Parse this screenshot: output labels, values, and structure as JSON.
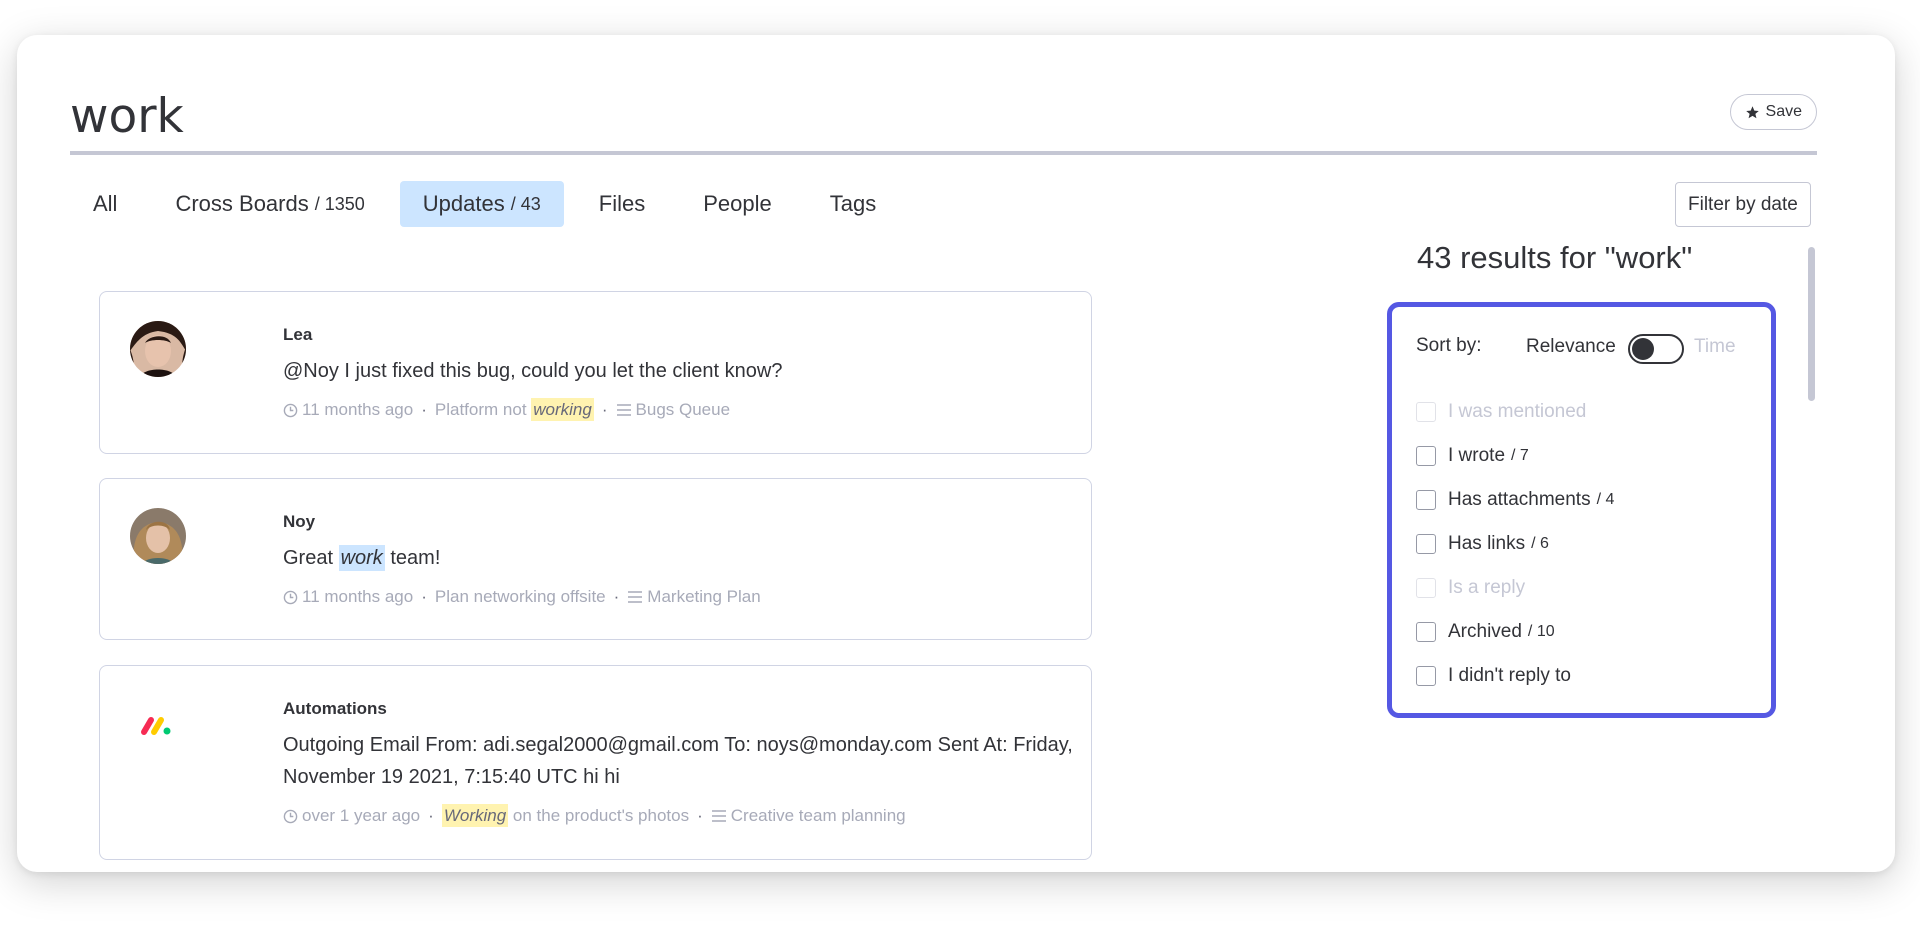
{
  "search": {
    "query": "work",
    "save_label": "Save"
  },
  "tabs": [
    {
      "label": "All",
      "count": ""
    },
    {
      "label": "Cross Boards",
      "count": "/ 1350"
    },
    {
      "label": "Updates",
      "count": "/ 43",
      "active": true
    },
    {
      "label": "Files",
      "count": ""
    },
    {
      "label": "People",
      "count": ""
    },
    {
      "label": "Tags",
      "count": ""
    }
  ],
  "filter_date_label": "Filter by date",
  "updates": [
    {
      "author": "Lea",
      "text": "@Noy I just fixed this bug, could you let the client know?",
      "time": "11 months ago",
      "item_pre": "Platform not ",
      "item_hl": "working",
      "item_post": "",
      "board": "Bugs Queue"
    },
    {
      "author": "Noy",
      "text_pre": "Great ",
      "text_hl": "work",
      "text_post": " team!",
      "time": "11 months ago",
      "item": "Plan networking offsite",
      "board": "Marketing Plan"
    },
    {
      "author": "Automations",
      "text": "Outgoing Email From: adi.segal2000@gmail.com To: noys@monday.com Sent At: Friday, November 19 2021, 7:15:40 UTC hi hi",
      "time": "over 1 year ago",
      "item_hl": "Working",
      "item_post": " on the product's photos",
      "board": "Creative team planning"
    }
  ],
  "results_title": "43 results for \"work\"",
  "sort": {
    "label": "Sort by:",
    "relevance": "Relevance",
    "time": "Time"
  },
  "filters": [
    {
      "label": "I was mentioned",
      "count": "",
      "disabled": true
    },
    {
      "label": "I wrote",
      "count": "/ 7",
      "disabled": false
    },
    {
      "label": "Has attachments",
      "count": "/ 4",
      "disabled": false
    },
    {
      "label": "Has links",
      "count": "/ 6",
      "disabled": false
    },
    {
      "label": "Is a reply",
      "count": "",
      "disabled": true
    },
    {
      "label": "Archived",
      "count": "/ 10",
      "disabled": false
    },
    {
      "label": "I didn't reply to",
      "count": "",
      "disabled": false
    }
  ],
  "colors": {
    "accent": "#5558e3",
    "tab_active": "#cce5ff",
    "highlight_yellow": "#fff3b0"
  },
  "icons": {
    "save": "star-icon",
    "time": "clock-icon",
    "board": "board-icon"
  }
}
